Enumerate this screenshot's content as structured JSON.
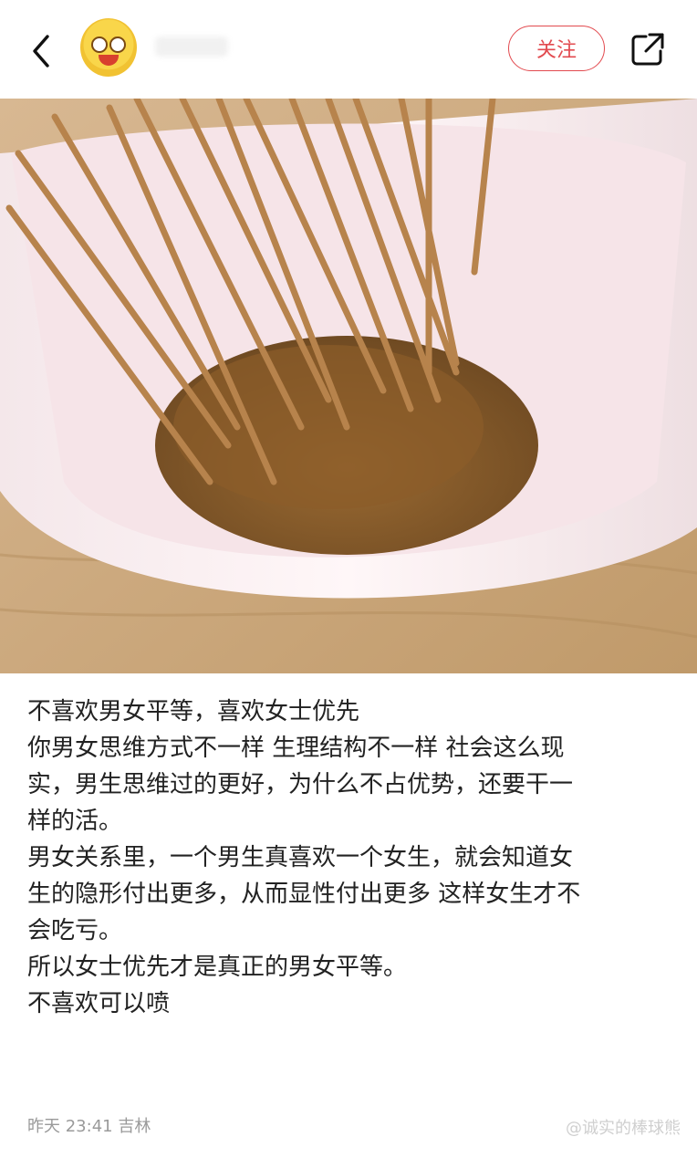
{
  "header": {
    "follow_label": "关注"
  },
  "post": {
    "lines": [
      "不喜欢男女平等，喜欢女士优先",
      "你男女思维方式不一样 生理结构不一样 社会这么现",
      "实，男生思维过的更好，为什么不占优势，还要干一",
      "样的活。",
      "男女关系里，一个男生真喜欢一个女生，就会知道女",
      "生的隐形付出更多，从而显性付出更多 这样女生才不",
      "会吃亏。",
      "所以女士优先才是真正的男女平等。",
      "不喜欢可以喷"
    ],
    "meta": "昨天 23:41 吉林",
    "watermark": "@诚实的棒球熊"
  },
  "icons": [
    "back-arrow-icon",
    "share-icon"
  ],
  "colors": {
    "accent": "#e24a4f",
    "text": "#222222",
    "meta": "#9a9a9a"
  }
}
